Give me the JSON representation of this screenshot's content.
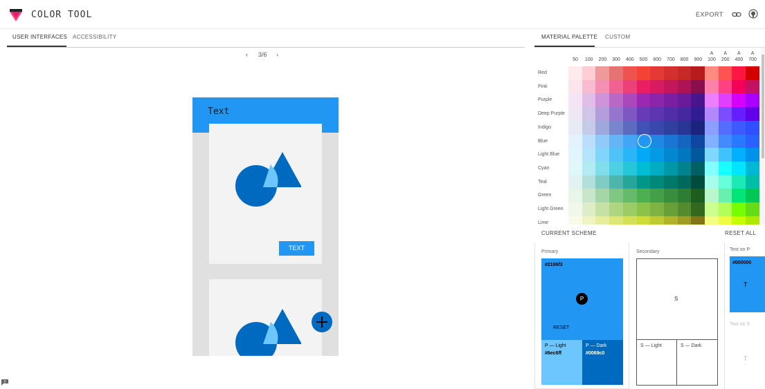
{
  "app": {
    "title": "COLOR TOOL",
    "export_label": "EXPORT",
    "brand_color": "#ff4081"
  },
  "left_tabs": [
    {
      "label": "USER INTERFACES",
      "active": true
    },
    {
      "label": "ACCESSIBILITY",
      "active": false
    }
  ],
  "pager": {
    "prev": "‹",
    "current": "3/6",
    "next": "›"
  },
  "preview": {
    "appbar_title": "Text",
    "button_label": "TEXT",
    "fab_icon": "plus-icon"
  },
  "right_tabs": [
    {
      "label": "MATERIAL PALETTE",
      "active": true
    },
    {
      "label": "CUSTOM",
      "active": false
    }
  ],
  "palette": {
    "columns": [
      "50",
      "100",
      "200",
      "300",
      "400",
      "500",
      "600",
      "700",
      "800",
      "900",
      "A 100",
      "A 200",
      "A 400",
      "A 700"
    ],
    "selected": {
      "row": "Blue",
      "column": "500"
    },
    "rows": [
      {
        "name": "Red",
        "colors": [
          "#ffebee",
          "#ffcdd2",
          "#ef9a9a",
          "#e57373",
          "#ef5350",
          "#f44336",
          "#e53935",
          "#d32f2f",
          "#c62828",
          "#b71c1c",
          "#ff8a80",
          "#ff5252",
          "#ff1744",
          "#d50000"
        ]
      },
      {
        "name": "Pink",
        "colors": [
          "#fce4ec",
          "#f8bbd0",
          "#f48fb1",
          "#f06292",
          "#ec407a",
          "#e91e63",
          "#d81b60",
          "#c2185b",
          "#ad1457",
          "#880e4f",
          "#ff80ab",
          "#ff4081",
          "#f50057",
          "#c51162"
        ]
      },
      {
        "name": "Purple",
        "colors": [
          "#f3e5f5",
          "#e1bee7",
          "#ce93d8",
          "#ba68c8",
          "#ab47bc",
          "#9c27b0",
          "#8e24aa",
          "#7b1fa2",
          "#6a1b9a",
          "#4a148c",
          "#ea80fc",
          "#e040fb",
          "#d500f9",
          "#aa00ff"
        ]
      },
      {
        "name": "Deep Purple",
        "colors": [
          "#ede7f6",
          "#d1c4e9",
          "#b39ddb",
          "#9575cd",
          "#7e57c2",
          "#673ab7",
          "#5e35b1",
          "#512da8",
          "#4527a0",
          "#311b92",
          "#b388ff",
          "#7c4dff",
          "#651fff",
          "#6200ea"
        ]
      },
      {
        "name": "Indigo",
        "colors": [
          "#e8eaf6",
          "#c5cae9",
          "#9fa8da",
          "#7986cb",
          "#5c6bc0",
          "#3f51b5",
          "#3949ab",
          "#303f9f",
          "#283593",
          "#1a237e",
          "#8c9eff",
          "#536dfe",
          "#3d5afe",
          "#304ffe"
        ]
      },
      {
        "name": "Blue",
        "colors": [
          "#e3f2fd",
          "#bbdefb",
          "#90caf9",
          "#64b5f6",
          "#42a5f5",
          "#2196f3",
          "#1e88e5",
          "#1976d2",
          "#1565c0",
          "#0d47a1",
          "#82b1ff",
          "#448aff",
          "#2979ff",
          "#2962ff"
        ]
      },
      {
        "name": "Light Blue",
        "colors": [
          "#e1f5fe",
          "#b3e5fc",
          "#81d4fa",
          "#4fc3f7",
          "#29b6f6",
          "#03a9f4",
          "#039be5",
          "#0288d1",
          "#0277bd",
          "#01579b",
          "#80d8ff",
          "#40c4ff",
          "#00b0ff",
          "#0091ea"
        ]
      },
      {
        "name": "Cyan",
        "colors": [
          "#e0f7fa",
          "#b2ebf2",
          "#80deea",
          "#4dd0e1",
          "#26c6da",
          "#00bcd4",
          "#00acc1",
          "#0097a7",
          "#00838f",
          "#006064",
          "#84ffff",
          "#18ffff",
          "#00e5ff",
          "#00b8d4"
        ]
      },
      {
        "name": "Teal",
        "colors": [
          "#e0f2f1",
          "#b2dfdb",
          "#80cbc4",
          "#4db6ac",
          "#26a69a",
          "#009688",
          "#00897b",
          "#00796b",
          "#00695c",
          "#004d40",
          "#a7ffeb",
          "#64ffda",
          "#1de9b6",
          "#00bfa5"
        ]
      },
      {
        "name": "Green",
        "colors": [
          "#e8f5e9",
          "#c8e6c9",
          "#a5d6a7",
          "#81c784",
          "#66bb6a",
          "#4caf50",
          "#43a047",
          "#388e3c",
          "#2e7d32",
          "#1b5e20",
          "#b9f6ca",
          "#69f0ae",
          "#00e676",
          "#00c853"
        ]
      },
      {
        "name": "Light Green",
        "colors": [
          "#f1f8e9",
          "#dcedc8",
          "#c5e1a5",
          "#aed581",
          "#9ccc65",
          "#8bc34a",
          "#7cb342",
          "#689f38",
          "#558b2f",
          "#33691e",
          "#ccff90",
          "#b2ff59",
          "#76ff03",
          "#64dd17"
        ]
      },
      {
        "name": "Lime",
        "colors": [
          "#f9fbe7",
          "#f0f4c3",
          "#e6ee9c",
          "#dce775",
          "#d4e157",
          "#cddc39",
          "#c0ca33",
          "#afb42b",
          "#9e9d24",
          "#827717",
          "#f4ff81",
          "#eeff41",
          "#c6ff00",
          "#aeea00"
        ]
      }
    ]
  },
  "scheme": {
    "heading": "CURRENT SCHEME",
    "reset_all_label": "RESET ALL",
    "primary": {
      "label": "Primary",
      "hex": "#2196f3",
      "letter": "P",
      "reset_label": "RESET",
      "light": {
        "name": "P — Light",
        "hex": "#6ec6ff"
      },
      "dark": {
        "name": "P — Dark",
        "hex": "#0069c0"
      }
    },
    "secondary": {
      "label": "Secondary",
      "letter": "S",
      "light_name": "S — Light",
      "dark_name": "S — Dark"
    },
    "text_on_p": {
      "label": "Text on P",
      "hex": "#000000",
      "letter": "T"
    },
    "text_on_s": {
      "label": "Text on S",
      "letter": "T"
    }
  }
}
